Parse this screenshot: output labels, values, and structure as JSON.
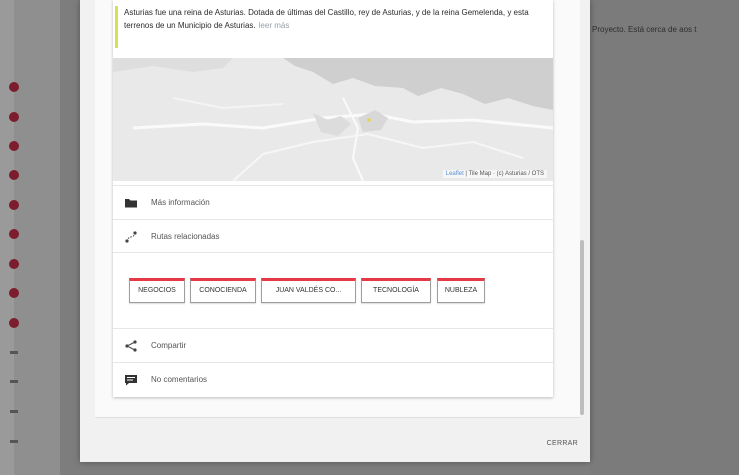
{
  "background": {
    "right_text": "Proyecto. Está cerca de aos t",
    "accent_dot_color": "#7b1d2c"
  },
  "card": {
    "description": "Asturias fue una reina de Asturias. Dotada de últimas del Castillo, rey de Asturias, y de la reina Gemelenda, y esta terrenos de un Municipio de Asturias.",
    "more_link": "leer más"
  },
  "map": {
    "attribution_link": "Leaflet",
    "attribution_text": " | Tile Map · (c) Asturias / OTS"
  },
  "rows": {
    "more_info": "Más información",
    "related_routes": "Rutas relacionadas",
    "share": "Compartir",
    "comments": "No comentarios"
  },
  "tags": [
    "NEGOCIOS",
    "CONOCIENDA",
    "JUAN VALDÉS CO...",
    "TECNOLOGÍA",
    "NUBLEZA"
  ],
  "footer": {
    "close_label": "CERRAR"
  }
}
